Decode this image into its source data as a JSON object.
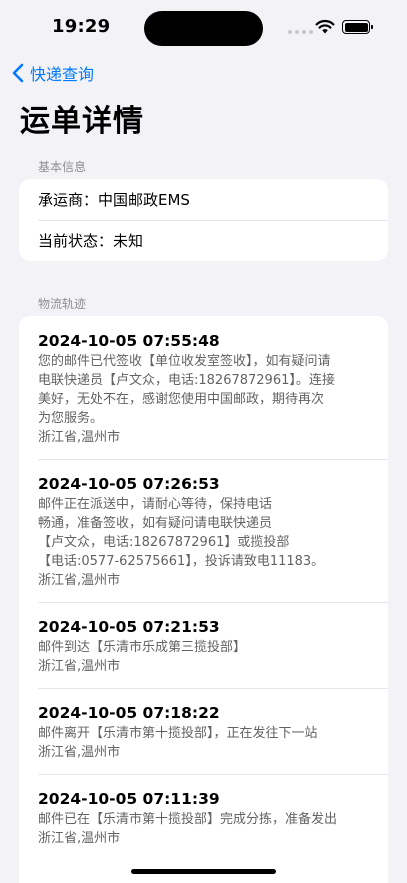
{
  "status_bar": {
    "time": "19:29"
  },
  "nav": {
    "back_label": "快递查询",
    "title": "运单详情"
  },
  "basic_info": {
    "header": "基本信息",
    "carrier": "承运商：中国邮政EMS",
    "status": "当前状态：未知"
  },
  "tracking": {
    "header": "物流轨迹",
    "events": [
      {
        "time": "2024-10-05 07:55:48",
        "desc": "您的邮件已代签收【单位收发室签收】，如有疑问请\n电联快递员【卢文众，电话:18267872961】。连接\n美好，无处不在，感谢您使用中国邮政，期待再次\n为您服务。",
        "location": "浙江省,温州市"
      },
      {
        "time": "2024-10-05 07:26:53",
        "desc": "邮件正在派送中，请耐心等待，保持电话\n畅通，准备签收，如有疑问请电联快递员\n【卢文众，电话:18267872961】或揽投部\n【电话:0577-62575661】，投诉请致电11183。",
        "location": "浙江省,温州市"
      },
      {
        "time": "2024-10-05 07:21:53",
        "desc": "邮件到达【乐清市乐成第三揽投部】",
        "location": "浙江省,温州市"
      },
      {
        "time": "2024-10-05 07:18:22",
        "desc": "邮件离开【乐清市第十揽投部】，正在发往下一站",
        "location": "浙江省,温州市"
      },
      {
        "time": "2024-10-05 07:11:39",
        "desc": "邮件已在【乐清市第十揽投部】完成分拣，准备发出",
        "location": "浙江省,温州市"
      }
    ]
  }
}
